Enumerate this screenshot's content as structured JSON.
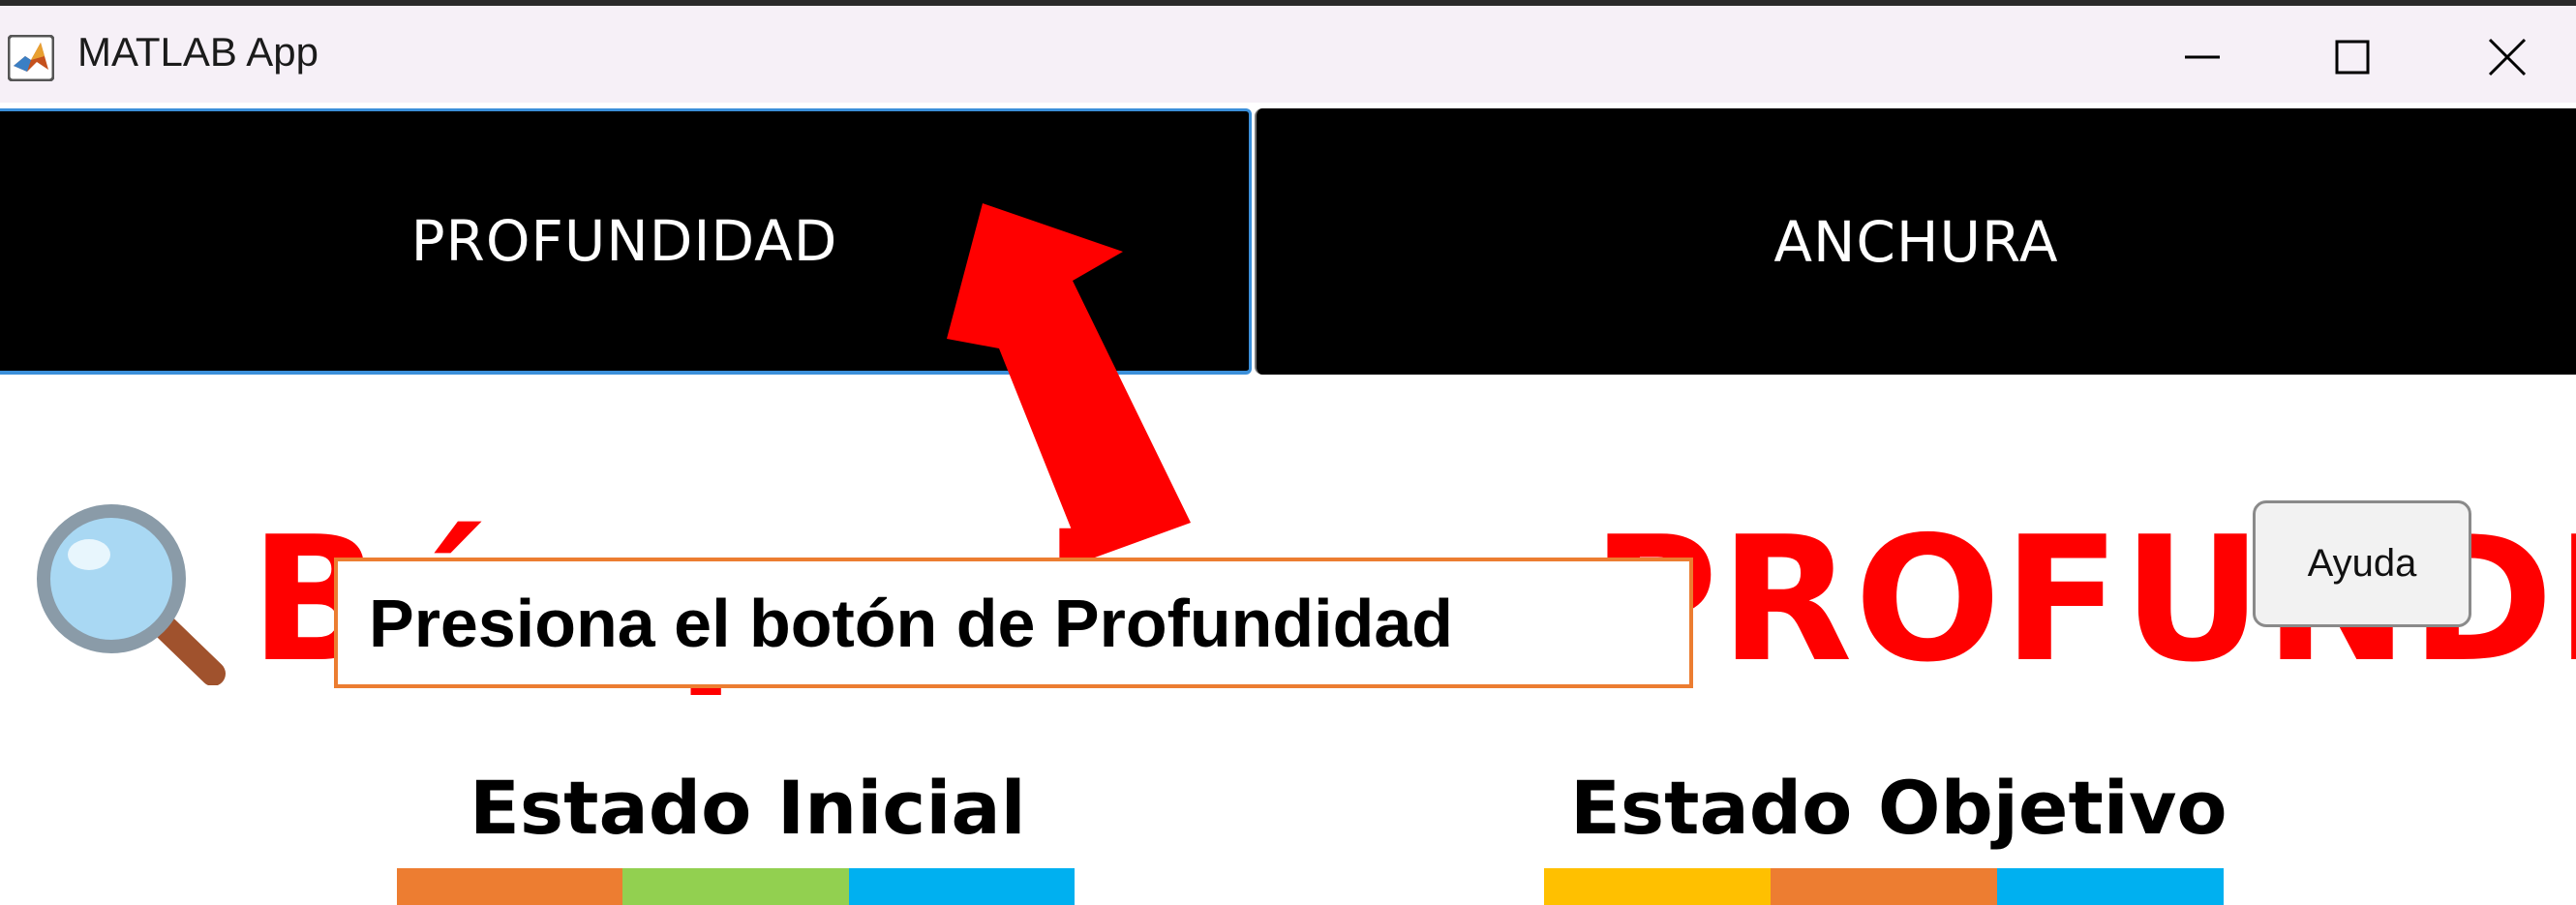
{
  "window": {
    "title": "MATLAB App",
    "minimize_icon": "minimize-icon",
    "maximize_icon": "maximize-icon",
    "close_icon": "close-icon"
  },
  "tabs": [
    {
      "label": "PROFUNDIDAD"
    },
    {
      "label": "ANCHURA"
    }
  ],
  "heading": {
    "icon": "magnifying-glass-icon",
    "text": "Búsqueda en PROFUNDIDAD",
    "color": "#ff0000"
  },
  "help_button": {
    "label": "Ayuda"
  },
  "callout": {
    "text": "Presiona el botón de Profundidad",
    "border_color": "#ec7d31"
  },
  "arrow": {
    "color": "#ff0000",
    "icon": "up-arrow-icon"
  },
  "states": {
    "initial": {
      "title": "Estado Inicial",
      "colors": [
        "#ed7d31",
        "#92d050",
        "#00b0f0"
      ]
    },
    "goal": {
      "title": "Estado Objetivo",
      "colors": [
        "#ffc000",
        "#ed7d31",
        "#00b0f0"
      ]
    }
  }
}
